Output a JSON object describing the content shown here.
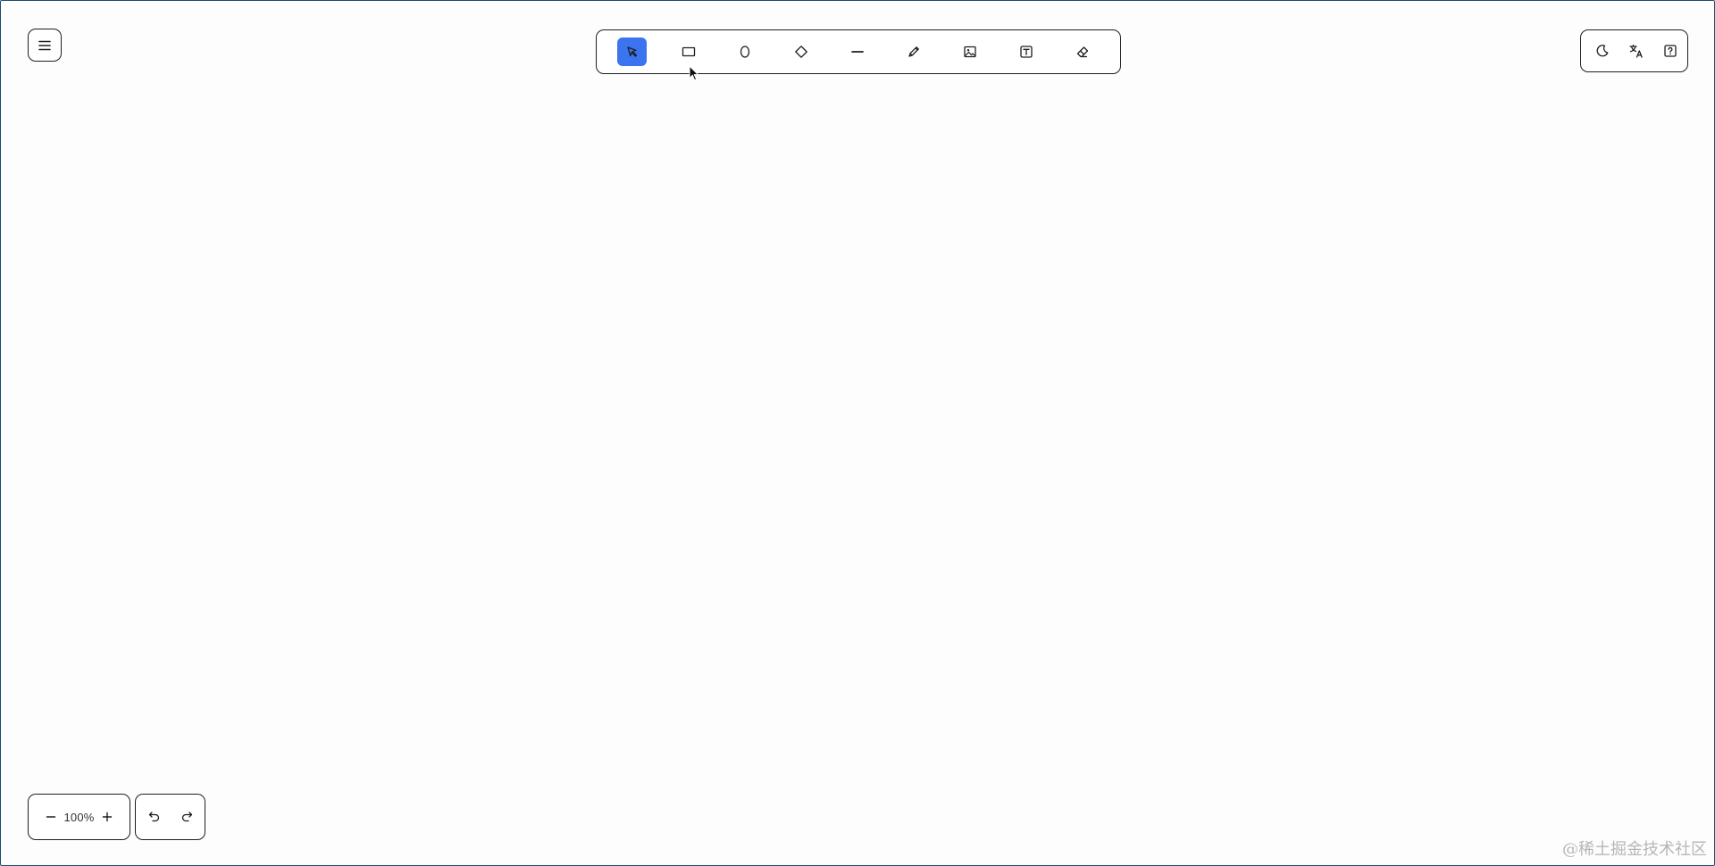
{
  "menu": {
    "icon": "hamburger-menu-icon"
  },
  "toolbar": {
    "tools": [
      {
        "name": "select",
        "icon": "pointer-arrow-icon",
        "active": true
      },
      {
        "name": "rectangle",
        "icon": "rectangle-icon",
        "active": false
      },
      {
        "name": "ellipse",
        "icon": "ellipse-icon",
        "active": false
      },
      {
        "name": "diamond",
        "icon": "diamond-icon",
        "active": false
      },
      {
        "name": "line",
        "icon": "line-icon",
        "active": false
      },
      {
        "name": "pencil",
        "icon": "pencil-icon",
        "active": false
      },
      {
        "name": "image",
        "icon": "image-icon",
        "active": false
      },
      {
        "name": "text",
        "icon": "text-box-icon",
        "active": false
      },
      {
        "name": "eraser",
        "icon": "eraser-icon",
        "active": false
      }
    ],
    "active_color": "#3b74ee"
  },
  "right_panel": {
    "buttons": [
      {
        "name": "theme",
        "icon": "moon-icon"
      },
      {
        "name": "language",
        "icon": "translate-icon"
      },
      {
        "name": "help",
        "icon": "help-icon"
      }
    ]
  },
  "zoom": {
    "value": "100%",
    "decrease_icon": "minus-icon",
    "increase_icon": "plus-icon"
  },
  "history": {
    "undo_icon": "undo-icon",
    "redo_icon": "redo-icon"
  },
  "watermark": "@稀土掘金技术社区"
}
